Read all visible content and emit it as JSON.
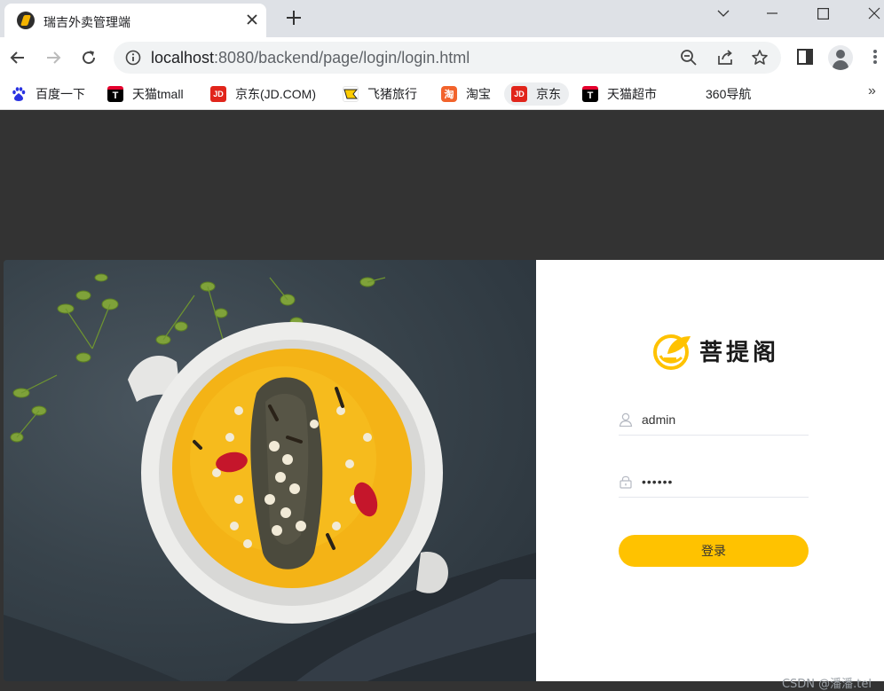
{
  "browser": {
    "tab_title": "瑞吉外卖管理端",
    "url_host": "localhost",
    "url_rest": ":8080/backend/page/login/login.html",
    "bookmarks": [
      {
        "label": "百度一下",
        "icon": "baidu-icon"
      },
      {
        "label": "天猫tmall",
        "icon": "tmall-icon"
      },
      {
        "label": "京东(JD.COM)",
        "icon": "jd-icon"
      },
      {
        "label": "飞猪旅行",
        "icon": "fliggy-icon"
      },
      {
        "label": "淘宝",
        "icon": "taobao-icon"
      },
      {
        "label": "京东",
        "icon": "jd-icon"
      },
      {
        "label": "天猫超市",
        "icon": "tmall-icon"
      },
      {
        "label": "360导航",
        "icon": ""
      }
    ]
  },
  "login": {
    "brand": "菩提阁",
    "username": "admin",
    "password": "••••••",
    "submit_label": "登录"
  },
  "watermark": "CSDN @潘潘.tel",
  "colors": {
    "accent": "#ffc200",
    "page_bg": "#333333",
    "panel_bg": "#ffffff"
  }
}
